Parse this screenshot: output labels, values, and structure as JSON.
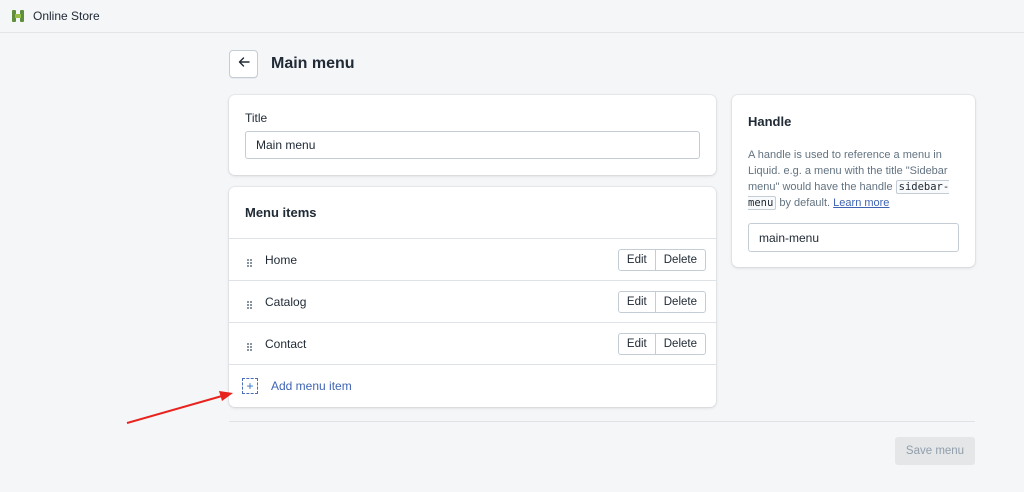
{
  "app": {
    "title": "Online Store",
    "logo_icon": "shopify-bag-icon"
  },
  "header": {
    "title": "Main menu",
    "back_icon": "arrow-left-icon"
  },
  "title_card": {
    "label": "Title",
    "value": "Main menu"
  },
  "menu_items": {
    "heading": "Menu items",
    "items": [
      {
        "label": "Home"
      },
      {
        "label": "Catalog"
      },
      {
        "label": "Contact"
      }
    ],
    "edit_label": "Edit",
    "delete_label": "Delete",
    "add_label": "Add menu item"
  },
  "handle": {
    "heading": "Handle",
    "desc_before": "A handle is used to reference a menu in Liquid. e.g. a menu with the title \"Sidebar menu\" would have the handle ",
    "code": "sidebar-menu",
    "desc_after": " by default. ",
    "learn_more": "Learn more",
    "value": "main-menu"
  },
  "footer": {
    "save_label": "Save menu"
  },
  "colors": {
    "accent": "#3f64b3",
    "annotation": "#e8231e"
  }
}
